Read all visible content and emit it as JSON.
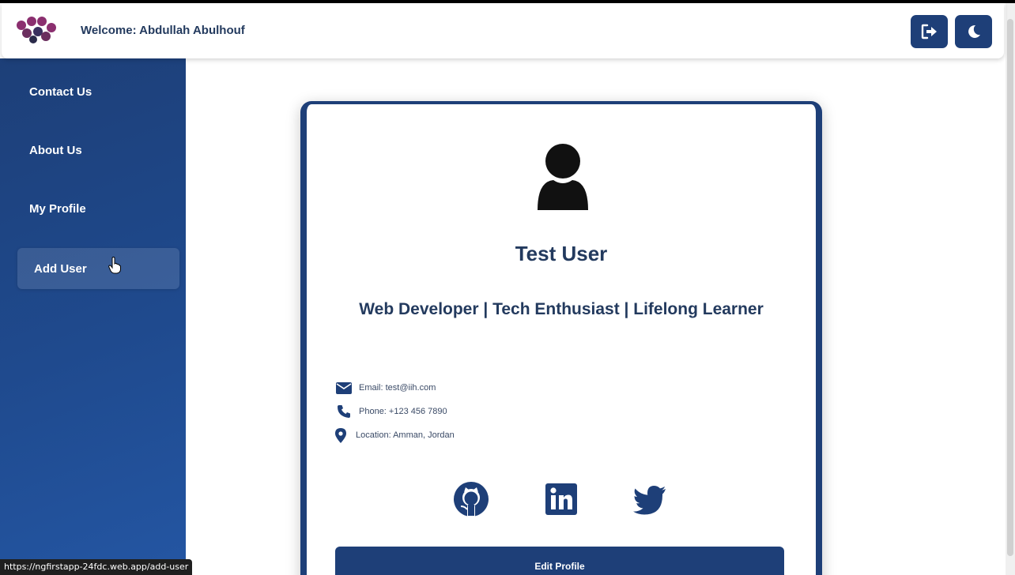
{
  "header": {
    "welcome_text": "Welcome: Abdullah Abulhouf",
    "logo_icon": "molecule-logo",
    "buttons": [
      {
        "icon": "logout-icon"
      },
      {
        "icon": "moon-icon"
      }
    ]
  },
  "sidebar": {
    "items": [
      {
        "label": "Contact Us",
        "active": false
      },
      {
        "label": "About Us",
        "active": false
      },
      {
        "label": "My Profile",
        "active": false
      },
      {
        "label": "Add User",
        "active": true
      }
    ]
  },
  "profile": {
    "avatar_icon": "user-icon",
    "name": "Test User",
    "tagline": "Web Developer | Tech Enthusiast | Lifelong Learner",
    "contacts": [
      {
        "icon": "envelope-icon",
        "text": "Email: test@iih.com"
      },
      {
        "icon": "phone-icon",
        "text": "Phone: +123 456 7890"
      },
      {
        "icon": "location-pin-icon",
        "text": "Location: Amman, Jordan"
      }
    ],
    "social": [
      {
        "icon": "github-icon"
      },
      {
        "icon": "linkedin-icon"
      },
      {
        "icon": "twitter-icon"
      }
    ],
    "edit_button_label": "Edit Profile"
  },
  "status_bar": {
    "url": "https://ngfirstapp-24fdc.web.app/add-user"
  },
  "colors": {
    "primary": "#1e3f78",
    "text_dark": "#233a5e",
    "logo_purple": "#8b2f6f"
  }
}
